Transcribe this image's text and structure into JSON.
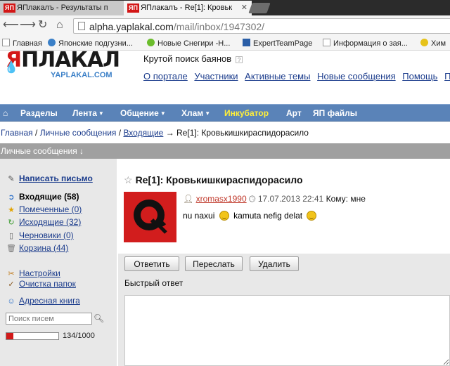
{
  "browser": {
    "tabs": [
      {
        "favicon": "ЯП",
        "title": "ЯПлакалъ - Результаты п"
      },
      {
        "favicon": "ЯП",
        "title": "ЯПлакалъ - Re[1]: Кровьк"
      }
    ],
    "url_host": "alpha.yaplakal.com",
    "url_path": "/mail/inbox/1947302/",
    "bookmarks": [
      "Главная",
      "Японские подгузни...",
      "Новые Снегири -Н...",
      "ExpertTeamPage",
      "Информация о зая...",
      "Хим"
    ]
  },
  "site": {
    "logo": {
      "text_red": "Я",
      "text_dark": "ПЛАКАЛ",
      "sub": "YAPLAKAL.COM"
    },
    "tagline": "Крутой поиск баянов",
    "tagline_help": "?",
    "top_links": [
      "О портале",
      "Участники",
      "Активные темы",
      "Новые сообщения",
      "Помощь",
      "Пр"
    ],
    "menu": [
      {
        "label": "Разделы",
        "dropdown": false,
        "highlight": false
      },
      {
        "label": "Лента",
        "dropdown": true,
        "highlight": false
      },
      {
        "label": "Общение",
        "dropdown": true,
        "highlight": false
      },
      {
        "label": "Хлам",
        "dropdown": true,
        "highlight": false
      },
      {
        "label": "Инкубатор",
        "dropdown": false,
        "highlight": true
      },
      {
        "label": "Арт",
        "dropdown": false,
        "highlight": false
      },
      {
        "label": "ЯП файлы",
        "dropdown": false,
        "highlight": false
      }
    ]
  },
  "breadcrumb": {
    "home": "Главная",
    "sep": "/",
    "messages": "Личные сообщения",
    "inbox": "Входящие",
    "arrow": "→",
    "current": "Re[1]: Кровькишкираспидорасило"
  },
  "section_title": "Личные сообщения ↓",
  "sidebar": {
    "compose": "Написать письмо",
    "folders": [
      {
        "label": "Входящие (58)",
        "icon": "arrow-in-icon",
        "bold": true
      },
      {
        "label": "Помеченные (0)",
        "icon": "star-icon",
        "bold": false
      },
      {
        "label": "Исходящие (32)",
        "icon": "arrow-out-icon",
        "bold": false
      },
      {
        "label": "Черновики (0)",
        "icon": "draft-icon",
        "bold": false
      },
      {
        "label": "Корзина (44)",
        "icon": "trash-icon",
        "bold": false
      }
    ],
    "settings": "Настройки",
    "clean": "Очистка папок",
    "addressbook": "Адресная книга",
    "search_placeholder": "Поиск писем",
    "quota_text": "134/1000",
    "quota_fraction": 0.134
  },
  "message": {
    "title": "Re[1]: Кровькишкираспидорасило",
    "author": "xromasx1990",
    "date": "17.07.2013 22:41",
    "to_label": "Кому:",
    "to": "мне",
    "text_1": "nu naxui",
    "text_2": "kamuta nefig delat",
    "buttons": {
      "reply": "Ответить",
      "forward": "Переслать",
      "delete": "Удалить"
    },
    "quick_reply_label": "Быстрый ответ"
  },
  "colors": {
    "menu_bg": "#5a83b8",
    "accent_red": "#d31616",
    "link": "#1b3c8c",
    "highlight": "#ffef3a"
  }
}
